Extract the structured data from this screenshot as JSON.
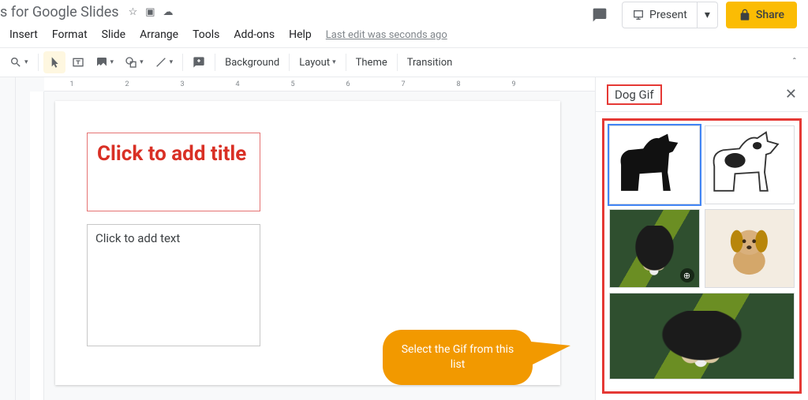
{
  "header": {
    "doc_title": "s for Google Slides",
    "star_tooltip": "Star",
    "move_tooltip": "Move",
    "cloud_tooltip": "See document status",
    "comments_tooltip": "Open comment history",
    "present_label": "Present",
    "share_label": "Share"
  },
  "menu": {
    "items": [
      "Insert",
      "Format",
      "Slide",
      "Arrange",
      "Tools",
      "Add-ons",
      "Help"
    ],
    "last_edit": "Last edit was seconds ago"
  },
  "toolbar": {
    "zoom_tooltip": "Zoom",
    "select_tooltip": "Select",
    "textbox_tooltip": "Text box",
    "image_tooltip": "Insert image",
    "shape_tooltip": "Shape",
    "line_tooltip": "Line",
    "comment_tooltip": "Add comment",
    "background_label": "Background",
    "layout_label": "Layout",
    "theme_label": "Theme",
    "transition_label": "Transition"
  },
  "ruler": {
    "ticks": [
      "1",
      "2",
      "3",
      "4",
      "5",
      "6",
      "7",
      "8",
      "9"
    ]
  },
  "slide": {
    "title_placeholder": "Click to add title",
    "text_placeholder": "Click to add text"
  },
  "callout": {
    "text": "Select the Gif from this list"
  },
  "sidepanel": {
    "title": "Dog Gif",
    "close_tooltip": "Close",
    "results": [
      {
        "name": "dog-silhouette",
        "alt": "Black dog silhouette"
      },
      {
        "name": "dog-outline",
        "alt": "Spotted dog outline"
      },
      {
        "name": "dog-photo-1",
        "alt": "Black and tan dog on grass"
      },
      {
        "name": "dog-tan-cartoon",
        "alt": "Tan puppy cartoon"
      },
      {
        "name": "dog-photo-2",
        "alt": "Black and tan dog on grass wide"
      }
    ]
  }
}
